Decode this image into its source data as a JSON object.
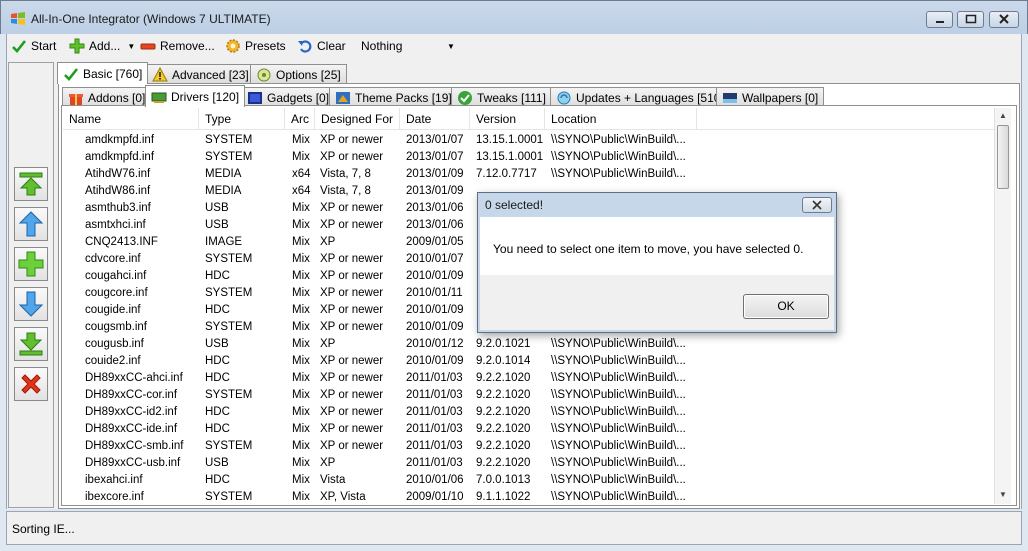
{
  "window": {
    "title": "All-In-One Integrator (Windows 7 ULTIMATE)"
  },
  "toolbar": {
    "start_label": "Start",
    "add_label": "Add...",
    "remove_label": "Remove...",
    "presets_label": "Presets",
    "clear_label": "Clear",
    "selector_value": "Nothing"
  },
  "top_tabs": [
    {
      "label": "Basic [760]"
    },
    {
      "label": "Advanced [23]"
    },
    {
      "label": "Options [25]"
    }
  ],
  "sub_tabs": [
    {
      "label": "Addons [0]"
    },
    {
      "label": "Drivers [120]"
    },
    {
      "label": "Gadgets [0]"
    },
    {
      "label": "Theme Packs [19]"
    },
    {
      "label": "Tweaks [111]"
    },
    {
      "label": "Updates + Languages [510]"
    },
    {
      "label": "Wallpapers [0]"
    }
  ],
  "columns": [
    "Name",
    "Type",
    "Arc",
    "Designed For",
    "Date",
    "Version",
    "Location"
  ],
  "rows": [
    [
      "amdkmpfd.inf",
      "SYSTEM",
      "Mix",
      "XP or newer",
      "2013/01/07",
      "13.15.1.0001",
      "\\\\SYNO\\Public\\WinBuild\\..."
    ],
    [
      "amdkmpfd.inf",
      "SYSTEM",
      "Mix",
      "XP or newer",
      "2013/01/07",
      "13.15.1.0001",
      "\\\\SYNO\\Public\\WinBuild\\..."
    ],
    [
      "AtihdW76.inf",
      "MEDIA",
      "x64",
      "Vista, 7, 8",
      "2013/01/09",
      "7.12.0.7717",
      "\\\\SYNO\\Public\\WinBuild\\..."
    ],
    [
      "AtihdW86.inf",
      "MEDIA",
      "x64",
      "Vista, 7, 8",
      "2013/01/09",
      "",
      ""
    ],
    [
      "asmthub3.inf",
      "USB",
      "Mix",
      "XP or newer",
      "2013/01/06",
      "",
      ""
    ],
    [
      "asmtxhci.inf",
      "USB",
      "Mix",
      "XP or newer",
      "2013/01/06",
      "",
      ""
    ],
    [
      "CNQ2413.INF",
      "IMAGE",
      "Mix",
      "XP",
      "2009/01/05",
      "",
      ""
    ],
    [
      "cdvcore.inf",
      "SYSTEM",
      "Mix",
      "XP or newer",
      "2010/01/07",
      "",
      ""
    ],
    [
      "cougahci.inf",
      "HDC",
      "Mix",
      "XP or newer",
      "2010/01/09",
      "",
      ""
    ],
    [
      "cougcore.inf",
      "SYSTEM",
      "Mix",
      "XP or newer",
      "2010/01/11",
      "",
      ""
    ],
    [
      "cougide.inf",
      "HDC",
      "Mix",
      "XP or newer",
      "2010/01/09",
      "",
      ""
    ],
    [
      "cougsmb.inf",
      "SYSTEM",
      "Mix",
      "XP or newer",
      "2010/01/09",
      "",
      ""
    ],
    [
      "cougusb.inf",
      "USB",
      "Mix",
      "XP",
      "2010/01/12",
      "9.2.0.1021",
      "\\\\SYNO\\Public\\WinBuild\\..."
    ],
    [
      "couide2.inf",
      "HDC",
      "Mix",
      "XP or newer",
      "2010/01/09",
      "9.2.0.1014",
      "\\\\SYNO\\Public\\WinBuild\\..."
    ],
    [
      "DH89xxCC-ahci.inf",
      "HDC",
      "Mix",
      "XP or newer",
      "2011/01/03",
      "9.2.2.1020",
      "\\\\SYNO\\Public\\WinBuild\\..."
    ],
    [
      "DH89xxCC-cor.inf",
      "SYSTEM",
      "Mix",
      "XP or newer",
      "2011/01/03",
      "9.2.2.1020",
      "\\\\SYNO\\Public\\WinBuild\\..."
    ],
    [
      "DH89xxCC-id2.inf",
      "HDC",
      "Mix",
      "XP or newer",
      "2011/01/03",
      "9.2.2.1020",
      "\\\\SYNO\\Public\\WinBuild\\..."
    ],
    [
      "DH89xxCC-ide.inf",
      "HDC",
      "Mix",
      "XP or newer",
      "2011/01/03",
      "9.2.2.1020",
      "\\\\SYNO\\Public\\WinBuild\\..."
    ],
    [
      "DH89xxCC-smb.inf",
      "SYSTEM",
      "Mix",
      "XP or newer",
      "2011/01/03",
      "9.2.2.1020",
      "\\\\SYNO\\Public\\WinBuild\\..."
    ],
    [
      "DH89xxCC-usb.inf",
      "USB",
      "Mix",
      "XP",
      "2011/01/03",
      "9.2.2.1020",
      "\\\\SYNO\\Public\\WinBuild\\..."
    ],
    [
      "ibexahci.inf",
      "HDC",
      "Mix",
      "Vista",
      "2010/01/06",
      "7.0.0.1013",
      "\\\\SYNO\\Public\\WinBuild\\..."
    ],
    [
      "ibexcore.inf",
      "SYSTEM",
      "Mix",
      "XP, Vista",
      "2009/01/10",
      "9.1.1.1022",
      "\\\\SYNO\\Public\\WinBuild\\..."
    ]
  ],
  "status": {
    "text": "Sorting IE..."
  },
  "dialog": {
    "title": "0 selected!",
    "message": "You need to select one item to move, you have selected 0.",
    "ok_label": "OK"
  },
  "colors": {
    "title_bar": "#c4d5e9",
    "check_green": "#1e9e1e",
    "remove_red": "#e0461f",
    "dialog_frame": "#c7d7ea"
  },
  "icons": {
    "title": "windows-logo-icon",
    "start": "check-icon",
    "add": "plus-icon",
    "remove": "minus-icon",
    "presets": "gear-icon",
    "clear": "undo-icon",
    "side": [
      "move-top-icon",
      "move-up-icon",
      "add-icon",
      "move-down-icon",
      "move-bottom-icon",
      "delete-icon"
    ]
  }
}
